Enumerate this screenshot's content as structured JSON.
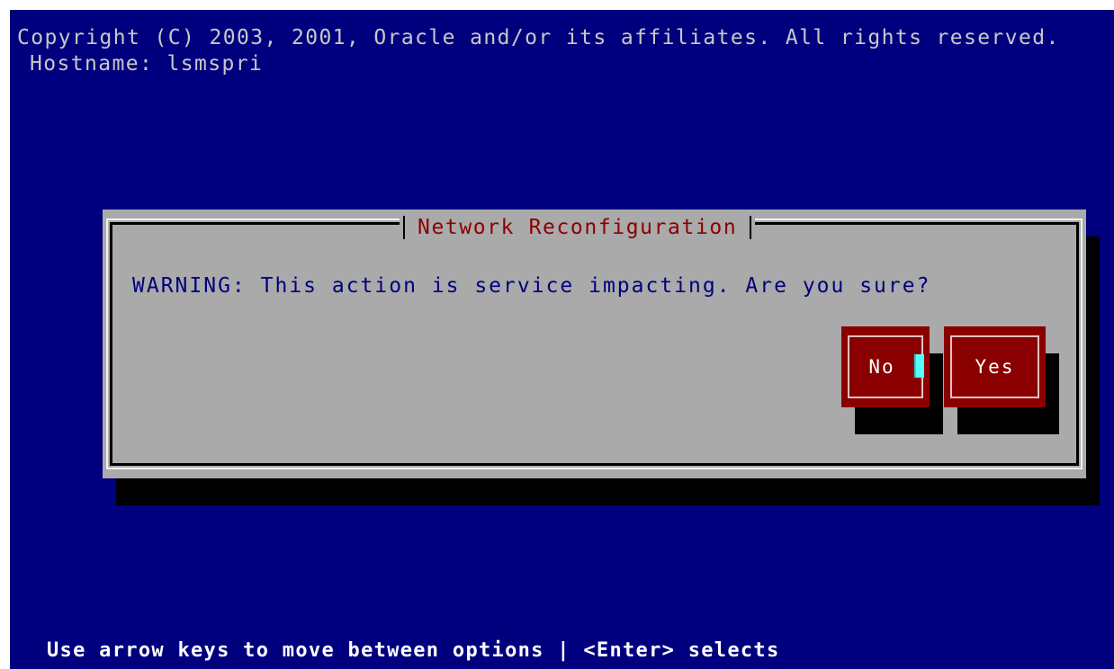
{
  "header": {
    "copyright": "Copyright (C) 2003, 2001, Oracle and/or its affiliates. All rights reserved.",
    "hostname": "Hostname: lsmspri"
  },
  "dialog": {
    "title": "Network Reconfiguration",
    "message": "WARNING: This action is service impacting. Are you sure?",
    "buttons": {
      "no_label": "No",
      "yes_label": "Yes"
    }
  },
  "footer": {
    "hint": "Use arrow keys to move between options | <Enter> selects"
  },
  "colors": {
    "screen_background": "#00007e",
    "dialog_background": "#aaaaaa",
    "title_text": "#8a0000",
    "message_text": "#00007e",
    "button_background": "#8a0000",
    "cursor": "#55ffff",
    "header_text": "#c8c8c8",
    "footer_text": "#ffffff"
  }
}
